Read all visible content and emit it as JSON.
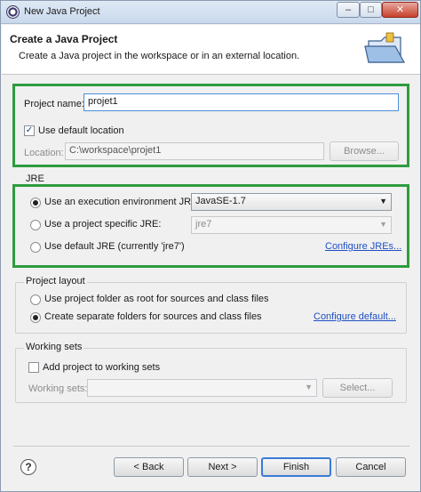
{
  "window": {
    "title": "New Java Project"
  },
  "header": {
    "title": "Create a Java Project",
    "description": "Create a Java project in the workspace or in an external location."
  },
  "project": {
    "name_label": "Project name:",
    "name_value": "projet1",
    "use_default_label": "Use default location",
    "use_default_checked": true,
    "location_label": "Location:",
    "location_value": "C:\\workspace\\projet1",
    "browse_label": "Browse..."
  },
  "jre": {
    "group_title": "JRE",
    "option_env_label": "Use an execution environment JRE:",
    "option_env_value": "JavaSE-1.7",
    "option_specific_label": "Use a project specific JRE:",
    "option_specific_value": "jre7",
    "option_default_label": "Use default JRE (currently 'jre7')",
    "configure_link": "Configure JREs..."
  },
  "layout": {
    "group_title": "Project layout",
    "option_root_label": "Use project folder as root for sources and class files",
    "option_separate_label": "Create separate folders for sources and class files",
    "configure_link": "Configure default..."
  },
  "working_sets": {
    "group_title": "Working sets",
    "add_label": "Add project to working sets",
    "sets_label": "Working sets:",
    "select_label": "Select..."
  },
  "footer": {
    "back_label": "< Back",
    "next_label": "Next >",
    "finish_label": "Finish",
    "cancel_label": "Cancel"
  },
  "colors": {
    "highlight": "#2e9c3f",
    "link": "#1f4fc4"
  }
}
